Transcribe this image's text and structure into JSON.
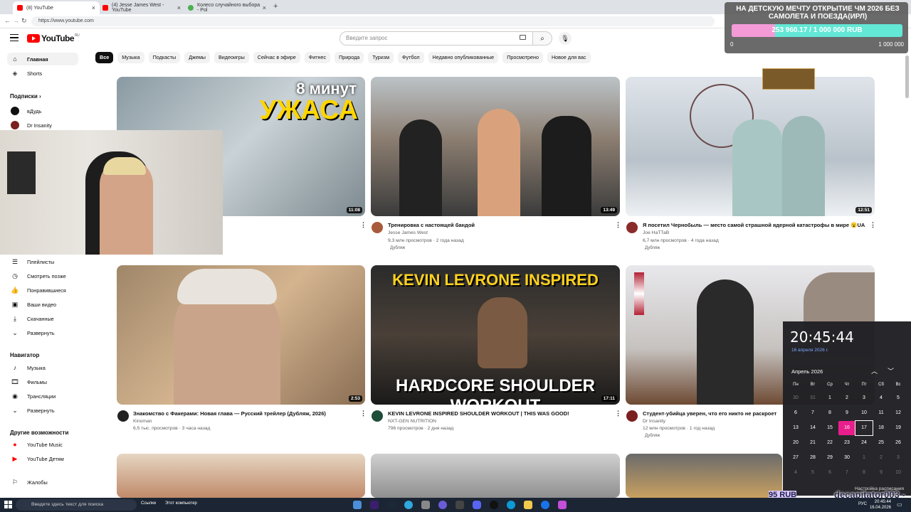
{
  "browser": {
    "tabs": [
      {
        "title": "(8) YouTube",
        "color": "#ff0000"
      },
      {
        "title": "(4) Jesse James West - YouTube",
        "color": "#ff0000"
      },
      {
        "title": "Колесо случайного выбора - Pol",
        "color": "#4caf50"
      }
    ],
    "url": "https://www.youtube.com"
  },
  "header": {
    "logo": "YouTube",
    "region": "RU",
    "search_placeholder": "Введите запрос"
  },
  "chips": [
    "Все",
    "Музыка",
    "Подкасты",
    "Джемы",
    "Видеоигры",
    "Сейчас в эфире",
    "Фитнес",
    "Природа",
    "Туризм",
    "Футбол",
    "Недавно опубликованные",
    "Просмотрено",
    "Новое для вас"
  ],
  "sidebar": {
    "main": [
      "Главная",
      "Shorts"
    ],
    "subs_head": "Подписки",
    "subs": [
      "вДудь",
      "Dr Insanity"
    ],
    "you": [
      "Плейлисты",
      "Смотреть позже",
      "Понравившиеся",
      "Ваши видео",
      "Скачанные",
      "Развернуть"
    ],
    "nav_head": "Навигатор",
    "nav": [
      "Музыка",
      "Фильмы",
      "Трансляции",
      "Развернуть"
    ],
    "more_head": "Другие возможности",
    "more": [
      "YouTube Music",
      "YouTube Детям"
    ],
    "complaints": "Жалобы"
  },
  "videos": [
    {
      "title": "",
      "channel": "",
      "meta": "",
      "duration": "11:08",
      "overlay1": "8 минут",
      "overlay2": "УЖАСА"
    },
    {
      "title": "Тренировка с настоящей бандой",
      "channel": "Jesse James West",
      "meta": "9,3 млн просмотров · 2 года назад",
      "duration": "13:49",
      "dub": "Дубляж"
    },
    {
      "title": "Я посетил Чернобыль — место самой страшной ядерной катастрофы в мире 😮UA",
      "channel": "Joe НаТТаВ",
      "meta": "6,7 млн просмотров · 4 года назад",
      "duration": "12:51",
      "dub": "Дубляж"
    },
    {
      "title": "Знакомство с Факерами: Новая глава — Русский трейлер (Дубляж, 2026)",
      "channel": "Kinoman",
      "meta": "6,5 тыс. просмотров · 3 часа назад",
      "duration": "2:53"
    },
    {
      "title": "KEVIN LEVRONE INSPIRED SHOULDER WORKOUT | THIS WAS GOOD!",
      "channel": "NXT-GEN NUTRITION",
      "meta": "796 просмотров · 2 дня назад",
      "duration": "17:11",
      "overlay1": "KEVIN LEVRONE INSPIRED",
      "overlay2": "HARDCORE SHOULDER WORKOUT"
    },
    {
      "title": "Студент-убийца уверен, что его никто не раскроет",
      "channel": "Dr Insanity",
      "meta": "12 млн просмотров · 1 год назад",
      "duration": "",
      "dub": "Дубляж"
    }
  ],
  "donation": {
    "title": "НА ДЕТСКУЮ МЕЧТУ ОТКРЫТИЕ ЧМ 2026 БЕЗ САМОЛЕТА И ПОЕЗДА(ИРЛ)",
    "progress_text": "253 960.17 / 1 000 000 RUB",
    "progress_fraction": 0.254,
    "min": "0",
    "max": "1 000 000"
  },
  "calendar": {
    "time": "20:45:44",
    "date": "16 апреля 2026 г.",
    "month": "Апрель 2026",
    "weekdays": [
      "Пн",
      "Вт",
      "Ср",
      "Чт",
      "Пт",
      "Сб",
      "Вс"
    ],
    "weeks": [
      [
        "30",
        "31",
        "1",
        "2",
        "3",
        "4",
        "5"
      ],
      [
        "6",
        "7",
        "8",
        "9",
        "10",
        "11",
        "12"
      ],
      [
        "13",
        "14",
        "15",
        "16",
        "17",
        "18",
        "19"
      ],
      [
        "20",
        "21",
        "22",
        "23",
        "24",
        "25",
        "26"
      ],
      [
        "27",
        "28",
        "29",
        "30",
        "1",
        "2",
        "3"
      ],
      [
        "4",
        "5",
        "6",
        "7",
        "8",
        "9",
        "10"
      ]
    ],
    "settings": "Настройка расписания"
  },
  "stream": {
    "nick": "decapitator003 - 20",
    "rub": "95 RUB"
  },
  "taskbar": {
    "search": "Введите здесь текст для поиска",
    "links": "Ссылки",
    "this_pc": "Этот компьютер",
    "lang": "РУС",
    "time": "20:45:44",
    "date": "16.04.2026"
  }
}
